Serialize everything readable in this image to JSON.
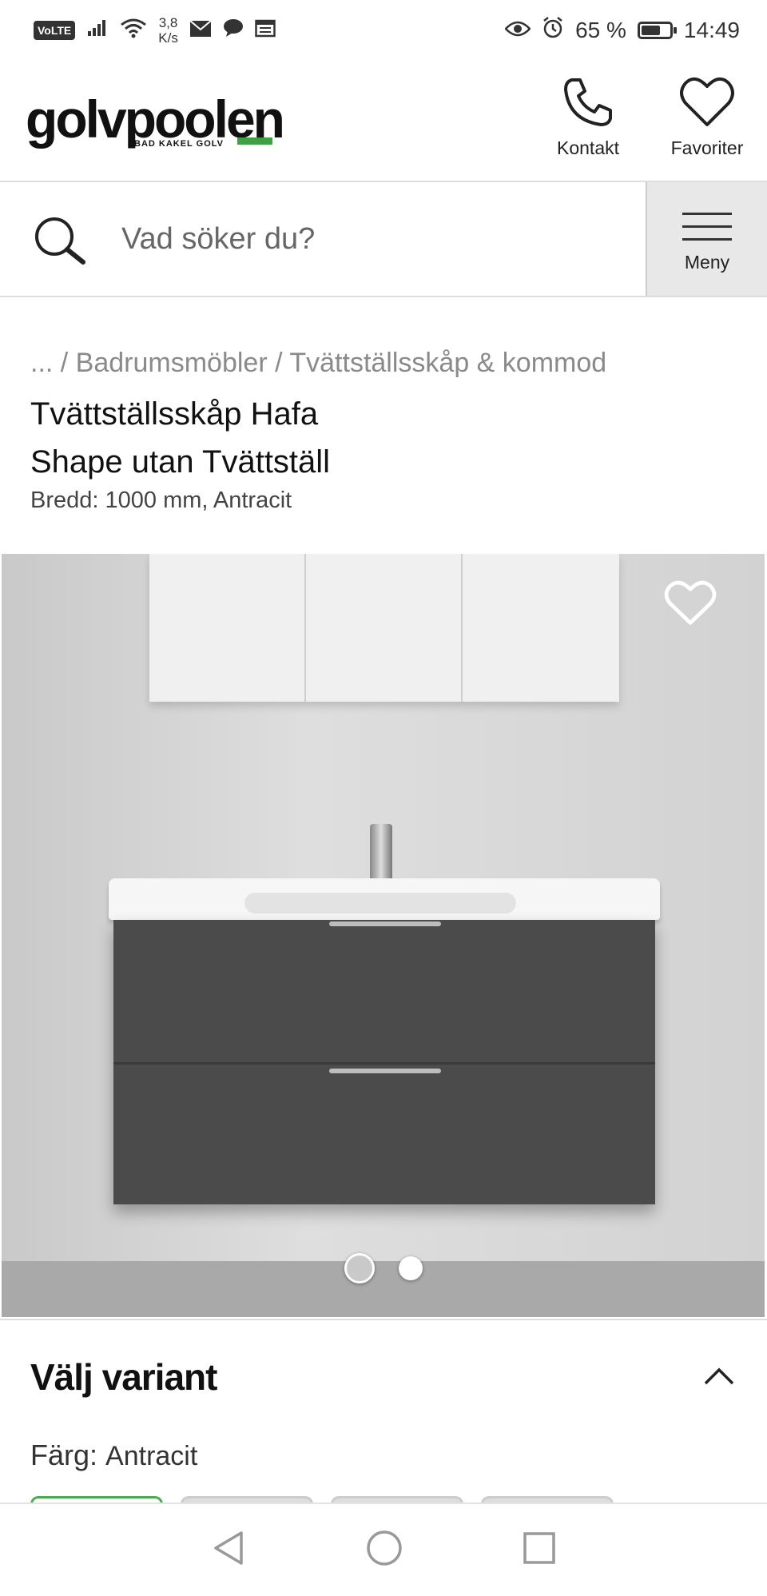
{
  "status_bar": {
    "network": "VoLTE",
    "speed_value": "3,8",
    "speed_unit": "K/s",
    "battery_percent": "65 %",
    "time": "14:49"
  },
  "header": {
    "logo_text": "golvpoolen",
    "logo_tagline": "BAD KAKEL GOLV",
    "contact_label": "Kontakt",
    "favorites_label": "Favoriter",
    "brand_green": "#3fa046"
  },
  "search": {
    "placeholder": "Vad söker du?",
    "menu_label": "Meny"
  },
  "product": {
    "breadcrumb": "... / Badrumsmöbler / Tvättställsskåp & kommod",
    "title_line1": "Tvättställsskåp Hafa",
    "title_line2": "Shape utan Tvättställ",
    "subtitle": "Bredd: 1000 mm, Antracit"
  },
  "gallery": {
    "slide_count": 2,
    "active_slide": 1
  },
  "variant": {
    "section_title": "Välj variant",
    "color_label": "Färg:",
    "color_value": "Antracit",
    "swatch_count": 4,
    "selected_swatch": 1,
    "selected_color": "#4caa50"
  }
}
